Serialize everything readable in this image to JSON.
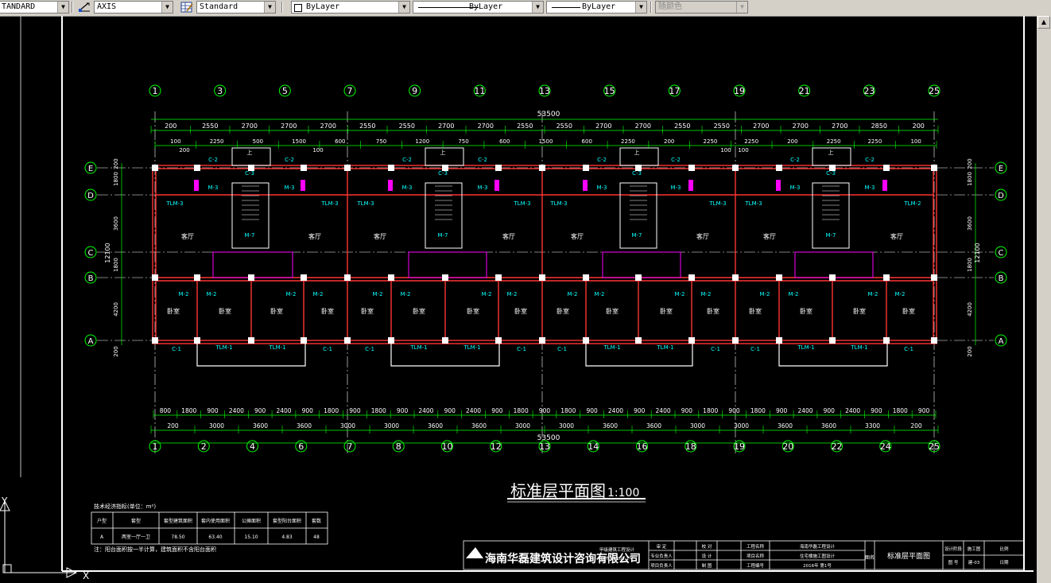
{
  "toolbar": {
    "text_style": "TANDARD",
    "dim_style": "AXIS",
    "table_style": "Standard",
    "layer_color": "ByLayer",
    "linetype": "ByLayer",
    "lineweight": "ByLayer",
    "plot_style": "随颜色"
  },
  "icons": [
    "dimension-style-icon",
    "table-style-icon",
    "scroll-up-icon",
    "ucs-icon"
  ],
  "colors": {
    "background": "#000000",
    "walls": "#ff3333",
    "text": "#ffffff",
    "axis": "#ffffff",
    "dimension": "#00ff00",
    "door": "#ffff00",
    "fixtures": "#ff00ff",
    "cyan": "#00ffff"
  },
  "drawing": {
    "top_axes": [
      "1",
      "3",
      "5",
      "7",
      "9",
      "11",
      "13",
      "15",
      "17",
      "19",
      "21",
      "23",
      "25"
    ],
    "bottom_axes": [
      "1",
      "2",
      "4",
      "6",
      "7",
      "8",
      "10",
      "12",
      "13",
      "14",
      "16",
      "18",
      "19",
      "20",
      "22",
      "24",
      "25"
    ],
    "row_axes_left": [
      "E",
      "D",
      "C",
      "B",
      "A"
    ],
    "row_axes_right": [
      "E",
      "D",
      "C",
      "B",
      "A"
    ],
    "top_total": "53500",
    "top_dims_row1": [
      "200",
      "2550",
      "2700",
      "2700",
      "2700",
      "2550",
      "2550",
      "2700",
      "2700",
      "2550",
      "2550",
      "2700",
      "2700",
      "2550",
      "2550",
      "2700",
      "2700",
      "2700",
      "2850",
      "200"
    ],
    "top_dims_row2": [
      "100",
      "2250",
      "500",
      "1500",
      "600",
      "750",
      "1200",
      "750",
      "600",
      "1500",
      "600",
      "2250",
      "200",
      "2250",
      "2250",
      "200",
      "2250",
      "2250",
      "100"
    ],
    "top_dims_row3": [
      "200",
      "100",
      "100",
      "100"
    ],
    "bottom_dims_row1": [
      "800",
      "1800",
      "900",
      "2400",
      "900",
      "2400",
      "900",
      "1800",
      "900",
      "1800",
      "900",
      "2400",
      "900",
      "2400",
      "900",
      "1800",
      "900",
      "1800",
      "900",
      "2400",
      "900",
      "2400",
      "900",
      "1800",
      "900",
      "1800",
      "900",
      "2400",
      "900",
      "2400",
      "900",
      "1800",
      "900"
    ],
    "bottom_dims_row2": [
      "200",
      "3000",
      "3600",
      "3600",
      "3000",
      "3000",
      "3600",
      "3600",
      "3000",
      "3000",
      "3600",
      "3600",
      "3000",
      "3000",
      "3600",
      "3600",
      "3300",
      "200"
    ],
    "bottom_total": "53500",
    "left_dims": [
      "200",
      "1800",
      "3600",
      "1800",
      "4200",
      "200"
    ],
    "left_total": "12100",
    "right_dims": [
      "200",
      "1800",
      "3600",
      "1800",
      "4200",
      "200"
    ],
    "right_total": "12100",
    "room_living": "客厅",
    "room_bedroom": "卧室",
    "door_tlm3": "TLM-3",
    "door_tlm2": "TLM-2",
    "door_tlm1": "TLM-1",
    "door_m2": "M-2",
    "door_m3": "M-3",
    "door_m7": "M-7",
    "window_c1": "C-1",
    "window_c2": "C-2",
    "window_c3": "C-3",
    "stair_label": "上",
    "title": "标准层平面图",
    "scale": "1:100"
  },
  "stats_table": {
    "caption": "技术经济指标(单位：m²)",
    "headers": [
      "户型",
      "套型",
      "套型建筑面积",
      "套内使用面积",
      "公摊面积",
      "套型阳台面积",
      "套数"
    ],
    "rows": [
      [
        "A",
        "两室一厅一卫",
        "78.50",
        "63.40",
        "15.10",
        "4.83",
        "48"
      ]
    ],
    "note": "注：阳台面积按一半计算，建筑面积不含阳台面积"
  },
  "title_block": {
    "company": "海南华磊建筑设计咨询有限公司",
    "cert_line1": "甲级建筑工程设计",
    "cert_line2": "证书 21603-1号",
    "sign_labels": [
      "审  定",
      "专业负责人",
      "项目负责人"
    ],
    "check_labels": [
      "校  对",
      "设  计",
      "制  图"
    ],
    "project_labels": [
      "工程名称",
      "项目名称",
      "工程编号"
    ],
    "project_values": [
      "海南华磊工程设计",
      "住宅楼施工图设计",
      "2016年  第1号"
    ],
    "drawing_name": "标准层平面图",
    "drawing_name_label": "图名",
    "meta_labels": [
      "设计阶段",
      "图  号"
    ],
    "meta_values": [
      "施工图",
      "建-03"
    ],
    "stamp_text": [
      "比例",
      "日期"
    ]
  },
  "ucs": {
    "x_label": "X",
    "y_label": "Y"
  }
}
